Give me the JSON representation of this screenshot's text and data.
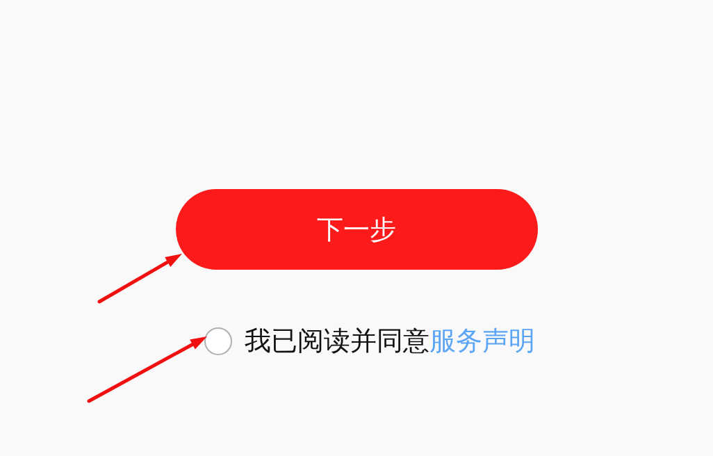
{
  "next_button": {
    "label": "下一步"
  },
  "agreement": {
    "checked": false,
    "text": "我已阅读并同意",
    "link": "服务声明"
  },
  "annotations": [
    {
      "kind": "arrow"
    },
    {
      "kind": "arrow"
    }
  ]
}
